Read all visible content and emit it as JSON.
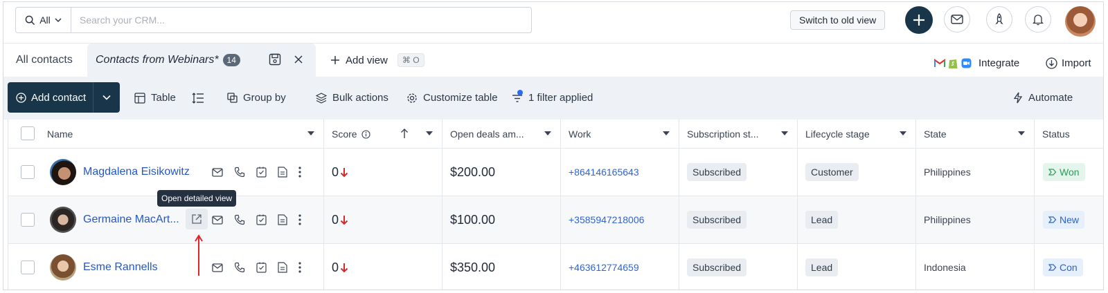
{
  "topbar": {
    "search_scope": "All",
    "search_placeholder": "Search your CRM...",
    "switch_view_label": "Switch to old view",
    "icons": [
      "search-icon",
      "chevron-down-icon",
      "plus-icon",
      "mail-icon",
      "rocket-icon",
      "bell-icon",
      "avatar"
    ]
  },
  "tabs": {
    "all_label": "All contacts",
    "active_label": "Contacts from Webinars*",
    "active_count": "14",
    "add_view_label": "Add view",
    "add_view_shortcut": "⌘ O",
    "integrate_label": "Integrate",
    "import_label": "Import"
  },
  "toolbar": {
    "add_contact_label": "Add contact",
    "table_label": "Table",
    "group_by_label": "Group by",
    "bulk_actions_label": "Bulk actions",
    "customize_label": "Customize table",
    "filter_label": "1 filter applied",
    "automate_label": "Automate"
  },
  "columns": [
    "Name",
    "Score",
    "Open deals am...",
    "Work",
    "Subscription st...",
    "Lifecycle stage",
    "State",
    "Status"
  ],
  "rows": [
    {
      "name": "Magdalena Eisikowitz",
      "score": "0",
      "amount": "$200.00",
      "phone": "+864146165643",
      "subscription": "Subscribed",
      "lifecycle": "Customer",
      "state": "Philippines",
      "status": "Won"
    },
    {
      "name": "Germaine MacArt...",
      "score": "0",
      "amount": "$100.00",
      "phone": "+3585947218006",
      "subscription": "Subscribed",
      "lifecycle": "Lead",
      "state": "Philippines",
      "status": "New"
    },
    {
      "name": "Esme Rannells",
      "score": "0",
      "amount": "$350.00",
      "phone": "+463612774659",
      "subscription": "Subscribed",
      "lifecycle": "Lead",
      "state": "Indonesia",
      "status": "Con"
    }
  ],
  "tooltip": "Open detailed view",
  "colors": {
    "primary": "#18354a",
    "link": "#2457c5",
    "down_arrow": "#d4292c",
    "won_bg": "#e4f6ec",
    "won_fg": "#2c9a5a",
    "new_bg": "#e6effc",
    "new_fg": "#2b63c7"
  }
}
